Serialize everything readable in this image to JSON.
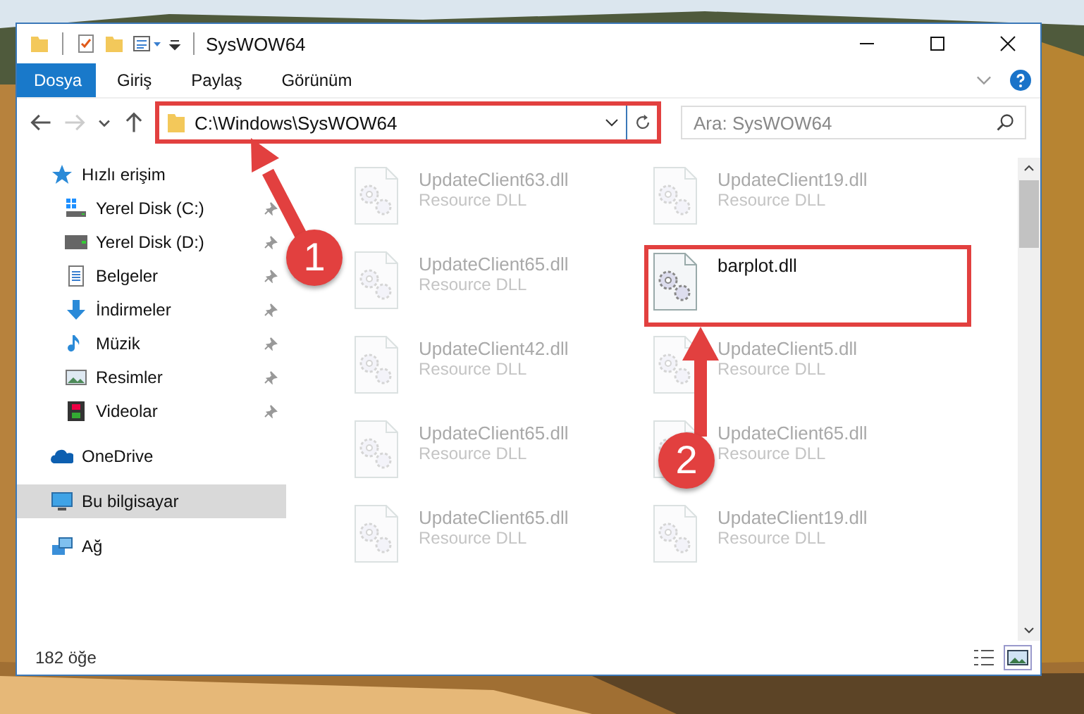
{
  "window": {
    "title": "SysWOW64"
  },
  "ribbon": {
    "tabs": [
      {
        "label": "Dosya",
        "kind": "file"
      },
      {
        "label": "Giriş",
        "kind": "tab"
      },
      {
        "label": "Paylaş",
        "kind": "tab"
      },
      {
        "label": "Görünüm",
        "kind": "tab"
      }
    ]
  },
  "nav_buttons": [
    {
      "kind": "back",
      "disabled": false
    },
    {
      "kind": "forward",
      "disabled": true
    },
    {
      "kind": "recent",
      "disabled": false
    },
    {
      "kind": "up",
      "disabled": false
    }
  ],
  "address_bar": {
    "value": "C:\\Windows\\SysWOW64",
    "highlighted": true
  },
  "search": {
    "placeholder": "Ara: SysWOW64"
  },
  "sidebar": {
    "sections": [
      {
        "label": "Hızlı erişim",
        "kind": "star",
        "selected": false,
        "children": [
          {
            "label": "Yerel Disk (C:)",
            "kind": "windisk",
            "pinned": true
          },
          {
            "label": "Yerel Disk (D:)",
            "kind": "disk",
            "pinned": true
          },
          {
            "label": "Belgeler",
            "kind": "docs",
            "pinned": true
          },
          {
            "label": "İndirmeler",
            "kind": "download",
            "pinned": true
          },
          {
            "label": "Müzik",
            "kind": "music",
            "pinned": true
          },
          {
            "label": "Resimler",
            "kind": "pictures",
            "pinned": true
          },
          {
            "label": "Videolar",
            "kind": "videos",
            "pinned": true
          }
        ]
      },
      {
        "label": "OneDrive",
        "kind": "cloud",
        "selected": false
      },
      {
        "label": "Bu bilgisayar",
        "kind": "pc",
        "selected": true
      },
      {
        "label": "Ağ",
        "kind": "network",
        "selected": false
      }
    ]
  },
  "files": [
    {
      "name": "UpdateClient63.dll",
      "type": "Resource DLL",
      "blurred": true,
      "highlighted": false
    },
    {
      "name": "UpdateClient19.dll",
      "type": "Resource DLL",
      "blurred": true,
      "highlighted": false
    },
    {
      "name": "UpdateClient65.dll",
      "type": "Resource DLL",
      "blurred": true,
      "highlighted": false
    },
    {
      "name": "barplot.dll",
      "blurred": false,
      "highlighted": true
    },
    {
      "name": "UpdateClient42.dll",
      "type": "Resource DLL",
      "blurred": true,
      "highlighted": false
    },
    {
      "name": "UpdateClient5.dll",
      "type": "Resource DLL",
      "blurred": true,
      "highlighted": false
    },
    {
      "name": "UpdateClient65.dll",
      "type": "Resource DLL",
      "blurred": true,
      "highlighted": false
    },
    {
      "name": "UpdateClient65.dll",
      "type": "Resource DLL",
      "blurred": true,
      "highlighted": false
    },
    {
      "name": "UpdateClient65.dll",
      "type": "Resource DLL",
      "blurred": true,
      "highlighted": false
    },
    {
      "name": "UpdateClient19.dll",
      "type": "Resource DLL",
      "blurred": true,
      "highlighted": false
    }
  ],
  "status_bar": {
    "count": "182 öğe",
    "views": [
      {
        "kind": "details",
        "selected": false
      },
      {
        "kind": "large",
        "selected": true
      }
    ]
  },
  "annotations": [
    {
      "number": "1"
    },
    {
      "number": "2"
    }
  ]
}
